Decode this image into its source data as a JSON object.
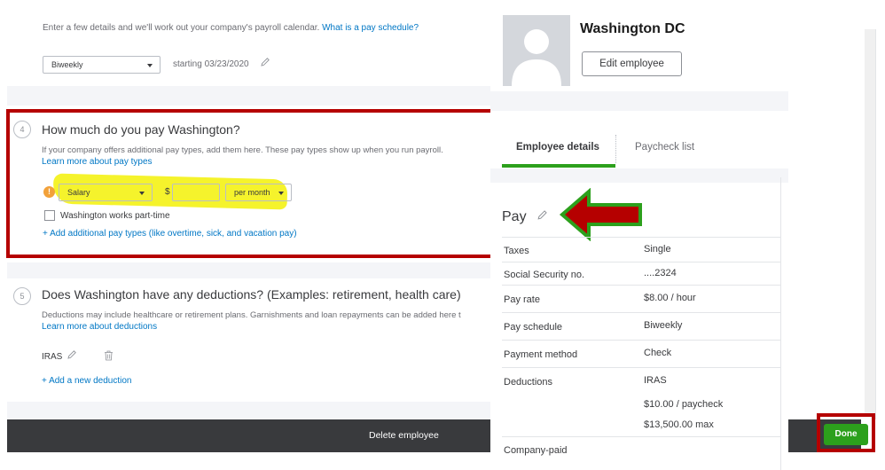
{
  "pay_schedule": {
    "intro_text": "Enter a few details and we'll work out your company's payroll calendar.",
    "intro_link": "What is a pay schedule?",
    "frequency": "Biweekly",
    "starting": "starting 03/23/2020"
  },
  "pay_section": {
    "step": "4",
    "title": "How much do you pay Washington?",
    "help": "If your company offers additional pay types, add them here. These pay types show up when you run payroll.",
    "learn_link": "Learn more about pay types",
    "pay_type": "Salary",
    "currency": "$",
    "amount": "",
    "period": "per month",
    "part_time_label": "Washington works part-time",
    "add_pay_link": "+ Add additional pay types (like overtime, sick, and vacation pay)"
  },
  "deductions_section": {
    "step": "5",
    "title": "Does Washington have any deductions? (Examples: retirement, health care)",
    "help": "Deductions may include healthcare or retirement plans. Garnishments and loan repayments can be added here t",
    "learn_link": "Learn more about deductions",
    "item": "IRAS",
    "add_link": "+ Add a new deduction"
  },
  "footer": {
    "delete_label": "Delete employee",
    "done_label": "Done"
  },
  "employee": {
    "name": "Washington DC",
    "edit_label": "Edit employee",
    "tabs": [
      "Employee details",
      "Paycheck list"
    ],
    "pay_title": "Pay",
    "rows": [
      {
        "label": "Taxes",
        "value": "Single"
      },
      {
        "label": "Social Security no.",
        "value": "....2324"
      },
      {
        "label": "Pay rate",
        "value": "$8.00 / hour"
      },
      {
        "label": "Pay schedule",
        "value": "Biweekly"
      },
      {
        "label": "Payment method",
        "value": "Check"
      },
      {
        "label": "Deductions",
        "value": "IRAS"
      }
    ],
    "deduction_amount": "$10.00 / paycheck",
    "deduction_max": "$13,500.00 max",
    "company_paid_label": "Company-paid"
  },
  "colors": {
    "brand_green": "#2ca01c",
    "link_blue": "#0077c5",
    "annotation_red": "#b50000",
    "highlight_yellow": "#f4f21a"
  },
  "icons": [
    "pencil-icon",
    "trash-icon",
    "warning-icon",
    "chevron-down-icon",
    "person-silhouette-icon",
    "arrow-annotation"
  ]
}
